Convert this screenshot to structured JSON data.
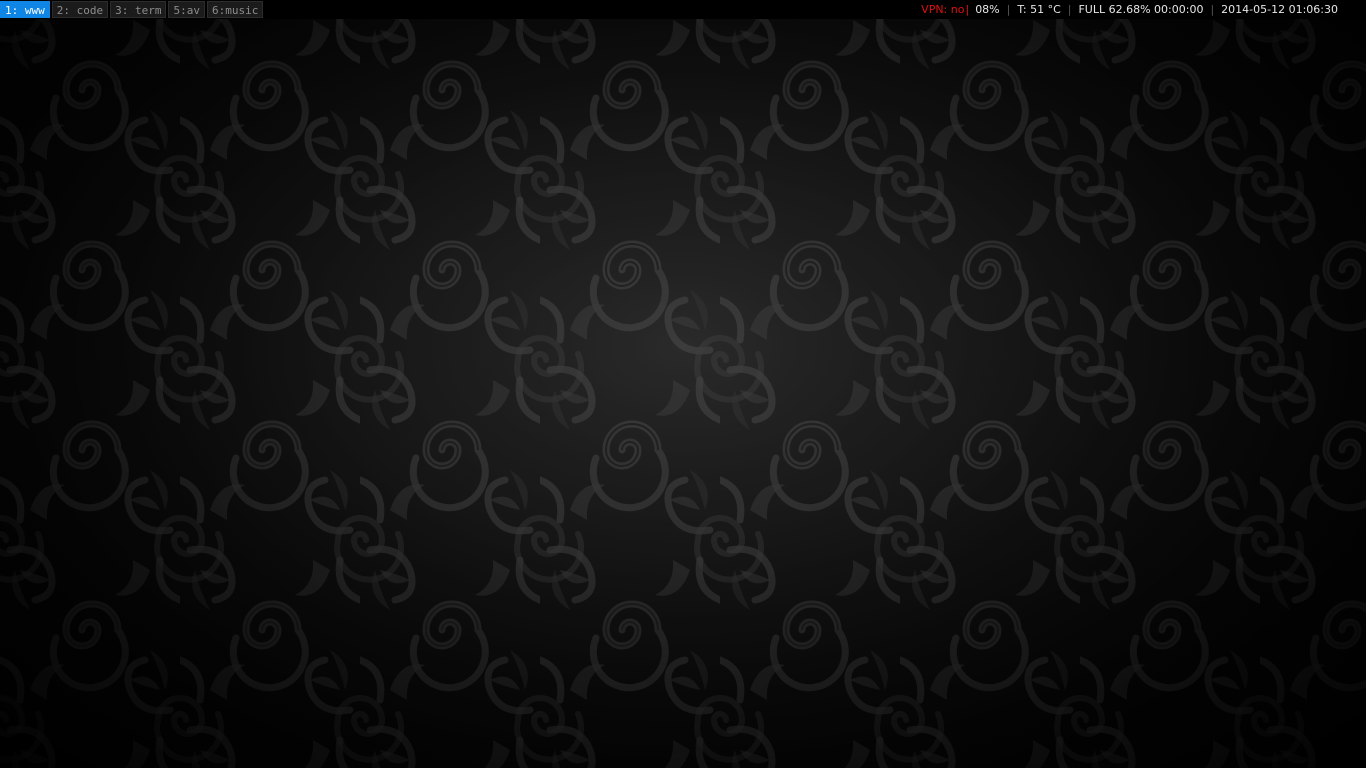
{
  "workspaces": [
    {
      "label": "1: www",
      "active": true
    },
    {
      "label": "2: code",
      "active": false
    },
    {
      "label": "3: term",
      "active": false
    },
    {
      "label": "5:av",
      "active": false
    },
    {
      "label": "6:music",
      "active": false
    }
  ],
  "status": {
    "vpn": "VPN: no",
    "cpu": "08%",
    "temp": "T: 51 °C",
    "battery": "FULL 62.68% 00:00:00",
    "datetime": "2014-05-12 01:06:30",
    "separator": "|"
  },
  "tray": {
    "icon": "network-tray-icon"
  },
  "colors": {
    "active_workspace": "#0f86e6",
    "vpn_warning": "#e01010",
    "bar_background": "#000000"
  }
}
